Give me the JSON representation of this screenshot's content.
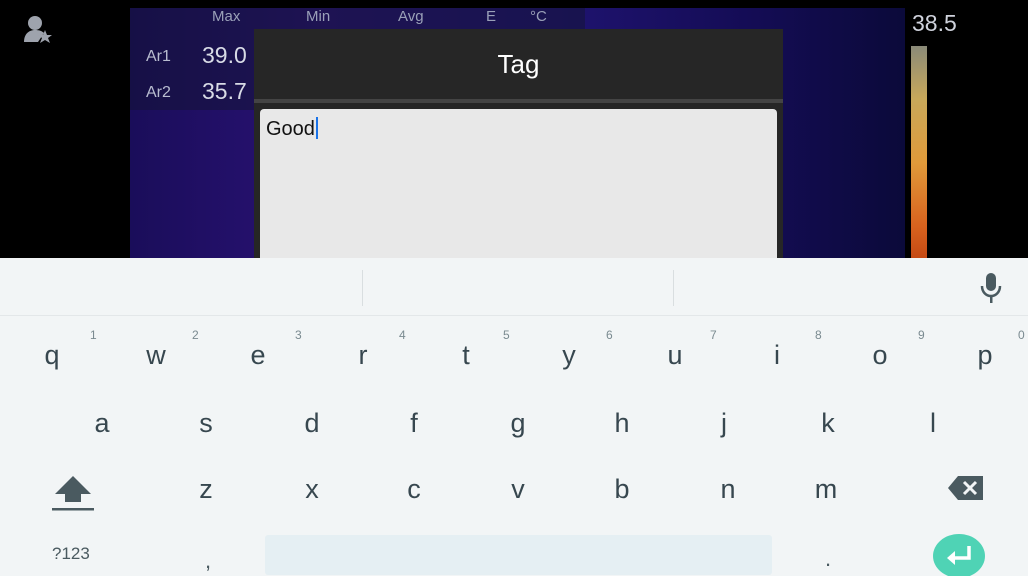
{
  "camera": {
    "headers": {
      "max": "Max",
      "min": "Min",
      "avg": "Avg",
      "e": "E",
      "unit": "°C"
    },
    "rows": [
      {
        "label": "Ar1",
        "value": "39.0"
      },
      {
        "label": "Ar2",
        "value": "35.7"
      }
    ],
    "scale_max": "38.5"
  },
  "dialog": {
    "title": "Tag",
    "input_value": "Good"
  },
  "keyboard": {
    "row1": [
      {
        "key": "q",
        "hint": "1"
      },
      {
        "key": "w",
        "hint": "2"
      },
      {
        "key": "e",
        "hint": "3"
      },
      {
        "key": "r",
        "hint": "4"
      },
      {
        "key": "t",
        "hint": "5"
      },
      {
        "key": "y",
        "hint": "6"
      },
      {
        "key": "u",
        "hint": "7"
      },
      {
        "key": "i",
        "hint": "8"
      },
      {
        "key": "o",
        "hint": "9"
      },
      {
        "key": "p",
        "hint": "0"
      }
    ],
    "row2": [
      "a",
      "s",
      "d",
      "f",
      "g",
      "h",
      "j",
      "k",
      "l"
    ],
    "row3": [
      "z",
      "x",
      "c",
      "v",
      "b",
      "n",
      "m"
    ],
    "symbols_label": "?123",
    "comma": ",",
    "period": "."
  },
  "colors": {
    "accent_enter": "#4fd3b5",
    "caret": "#1a73e8",
    "dialog_bg": "#262626"
  },
  "icons": [
    "user-star-icon",
    "mic-icon",
    "shift-icon",
    "backspace-icon",
    "enter-icon"
  ]
}
